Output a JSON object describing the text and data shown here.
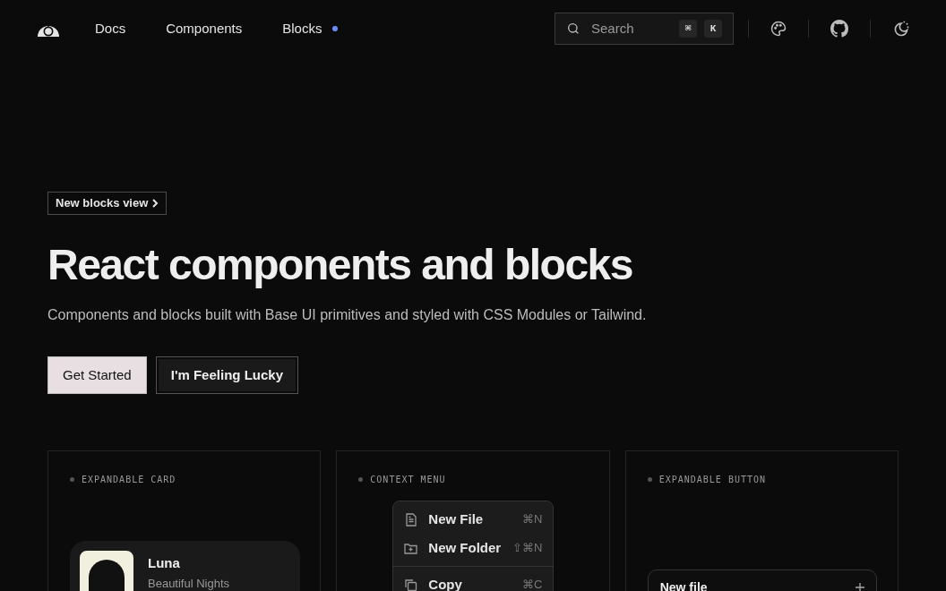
{
  "nav": {
    "links": [
      {
        "label": "Docs",
        "new": false
      },
      {
        "label": "Components",
        "new": false
      },
      {
        "label": "Blocks",
        "new": true
      }
    ],
    "search": {
      "placeholder": "Search",
      "keys": [
        "⌘",
        "K"
      ]
    }
  },
  "hero": {
    "badge": "New blocks view",
    "title": "React components and blocks",
    "subtitle": "Components and blocks built with Base UI primitives and styled with CSS Modules or Tailwind.",
    "buttons": [
      {
        "label": "Get Started",
        "kind": "primary"
      },
      {
        "label": "I'm Feeling Lucky",
        "kind": "secondary"
      }
    ]
  },
  "demos": [
    {
      "kind": "card",
      "label": "EXPANDABLE CARD",
      "title": "Luna",
      "subtitle": "Beautiful Nights"
    },
    {
      "kind": "menu",
      "label": "CONTEXT MENU",
      "groups": [
        [
          {
            "kind": "file",
            "label": "New File",
            "shortcut": "⌘N"
          },
          {
            "kind": "folder",
            "label": "New Folder",
            "shortcut": "⇧⌘N"
          }
        ],
        [
          {
            "kind": "copy",
            "label": "Copy",
            "shortcut": "⌘C"
          }
        ]
      ]
    },
    {
      "kind": "button",
      "label": "EXPANDABLE BUTTON",
      "button": "New file"
    }
  ]
}
